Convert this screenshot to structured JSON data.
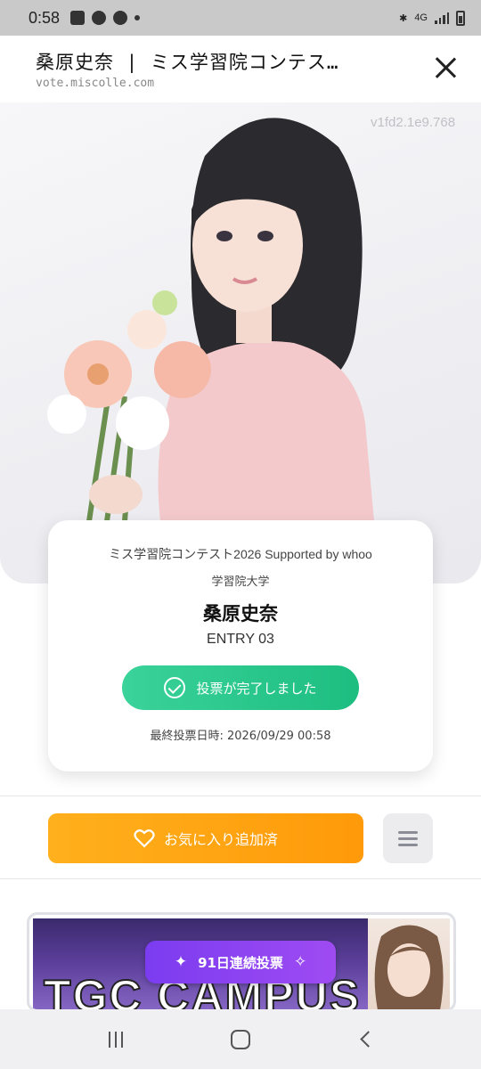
{
  "status_bar": {
    "time": "0:58",
    "network": "4G"
  },
  "header": {
    "title": "桑原史奈 | ミス学習院コンテス…",
    "url": "vote.miscolle.com"
  },
  "photo": {
    "watermark": "v1fd2.1e9.768"
  },
  "card": {
    "contest": "ミス学習院コンテスト2026 Supported by whoo",
    "school": "学習院大学",
    "name": "桑原史奈",
    "entry": "ENTRY 03",
    "vote_status": "投票が完了しました",
    "last_vote": "最終投票日時: 2026/09/29 00:58"
  },
  "actions": {
    "favorite_label": "お気に入り追加済"
  },
  "banner": {
    "text": "TGC CAMPUS",
    "streak_label": "91日連続投票"
  },
  "colors": {
    "vote_green": "#1dbd80",
    "favorite_orange": "#ff9a0a",
    "streak_purple": "#8a44f1"
  }
}
